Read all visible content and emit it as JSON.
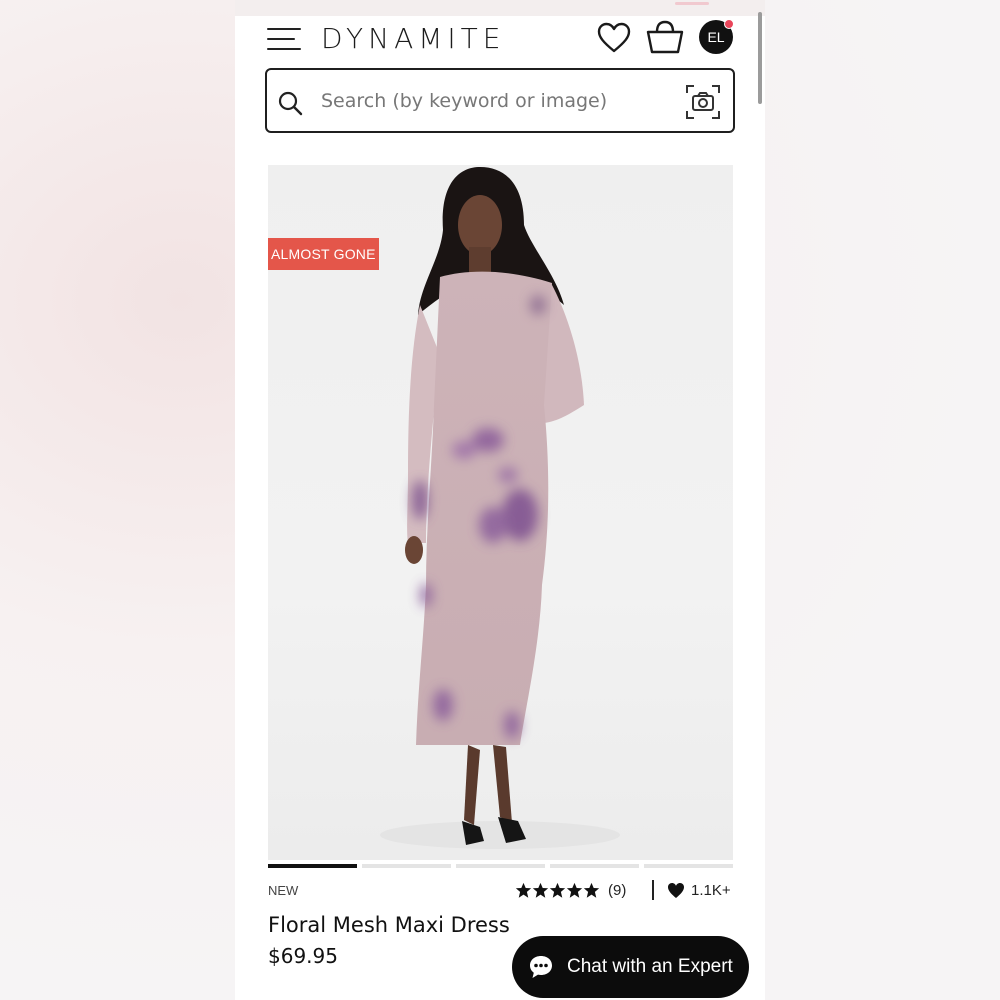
{
  "header": {
    "brand": "DYNAMITE",
    "avatar_initials": "EL",
    "notification_color": "#e9455a"
  },
  "search": {
    "placeholder": "Search (by keyword or image)"
  },
  "product": {
    "badge": "ALMOST GONE",
    "badge_color": "#e4564a",
    "image_count": 5,
    "active_image_index": 0,
    "tag": "NEW",
    "rating_stars": 5,
    "review_count": "(9)",
    "likes": "1.1K+",
    "title": "Floral Mesh Maxi Dress",
    "price": "$69.95"
  },
  "chat": {
    "label": "Chat with an Expert"
  },
  "icons": [
    "menu-icon",
    "heart-icon",
    "shopping-bag-icon",
    "search-icon",
    "camera-icon",
    "star-icon",
    "chat-bubble-icon"
  ]
}
